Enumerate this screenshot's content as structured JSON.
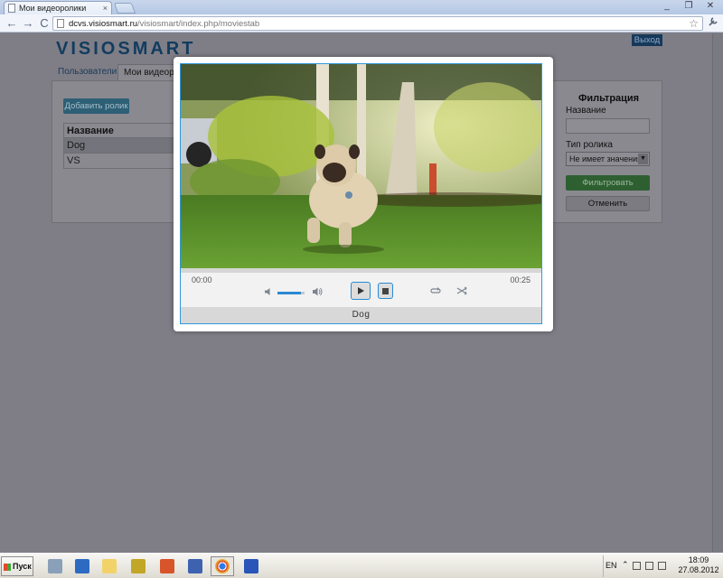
{
  "browser": {
    "tab_title": "Мои видеоролики",
    "tab_close": "×",
    "url_host": "dcvs.visiosmart.ru",
    "url_path": "/visiosmart/index.php/moviestab",
    "back": "←",
    "forward": "→",
    "reload": "C",
    "star": "☆",
    "wrench": "🔧",
    "minimize": "_",
    "restore": "❐",
    "close": "✕"
  },
  "app": {
    "logo": "VISIOSMART",
    "logout": "Выход",
    "tabs": [
      "Пользователи",
      "Мои видеоро..."
    ],
    "add_button": "Добавить ролик",
    "table": {
      "header": "Название",
      "rows": [
        "Dog",
        "VS"
      ]
    },
    "filter": {
      "title": "Фильтрация",
      "name_label": "Название",
      "type_label": "Тип ролика",
      "type_selected": "Не имеет значения",
      "apply": "Фильтровать",
      "cancel": "Отменить"
    }
  },
  "player": {
    "current_time": "00:00",
    "total_time": "00:25",
    "volume_fraction": 0.85,
    "caption": "Dog",
    "icons": {
      "volume_low": "volume-low-icon",
      "volume_high": "volume-high-icon",
      "play": "play-icon",
      "stop": "stop-icon",
      "loop": "loop-icon",
      "shuffle": "shuffle-icon"
    }
  },
  "taskbar": {
    "start": "Пуск",
    "lang": "EN",
    "time": "18:09",
    "date": "27.08.2012"
  },
  "colors": {
    "accent_blue": "#2a8ad2",
    "overlay": "#7f7e86",
    "filter_green": "#2e5f31"
  }
}
